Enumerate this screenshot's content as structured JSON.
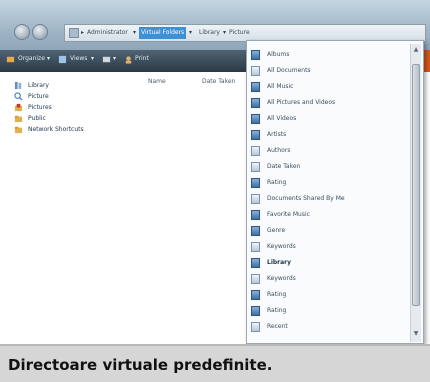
{
  "addressbar": {
    "crumbs": [
      "Administrator",
      "Virtual Folders",
      "Library",
      "Picture"
    ],
    "selected": "Virtual Folders"
  },
  "toolbar": {
    "organize": "Organize",
    "views": "Views",
    "extra": "Print"
  },
  "navpane": {
    "items": [
      "Library",
      "Picture",
      "Pictures",
      "Public",
      "Network Shortcuts"
    ]
  },
  "filelist": {
    "columns": [
      "Name",
      "Date Taken"
    ]
  },
  "dropdown": {
    "items": [
      "Albums",
      "All Documents",
      "All Music",
      "All Pictures and Videos",
      "All Videos",
      "Artists",
      "Authors",
      "Date Taken",
      "Rating",
      "Documents Shared By Me",
      "Favorite Music",
      "Genre",
      "Keywords",
      "Library",
      "Keywords",
      "Rating",
      "Rating",
      "Recent"
    ],
    "highlighted": "Library"
  },
  "caption": "Directoare virtuale predefinite.",
  "colors": {
    "toolbar": "#2a3945",
    "selection": "#3d8fd6",
    "accent": "#d5571a"
  }
}
